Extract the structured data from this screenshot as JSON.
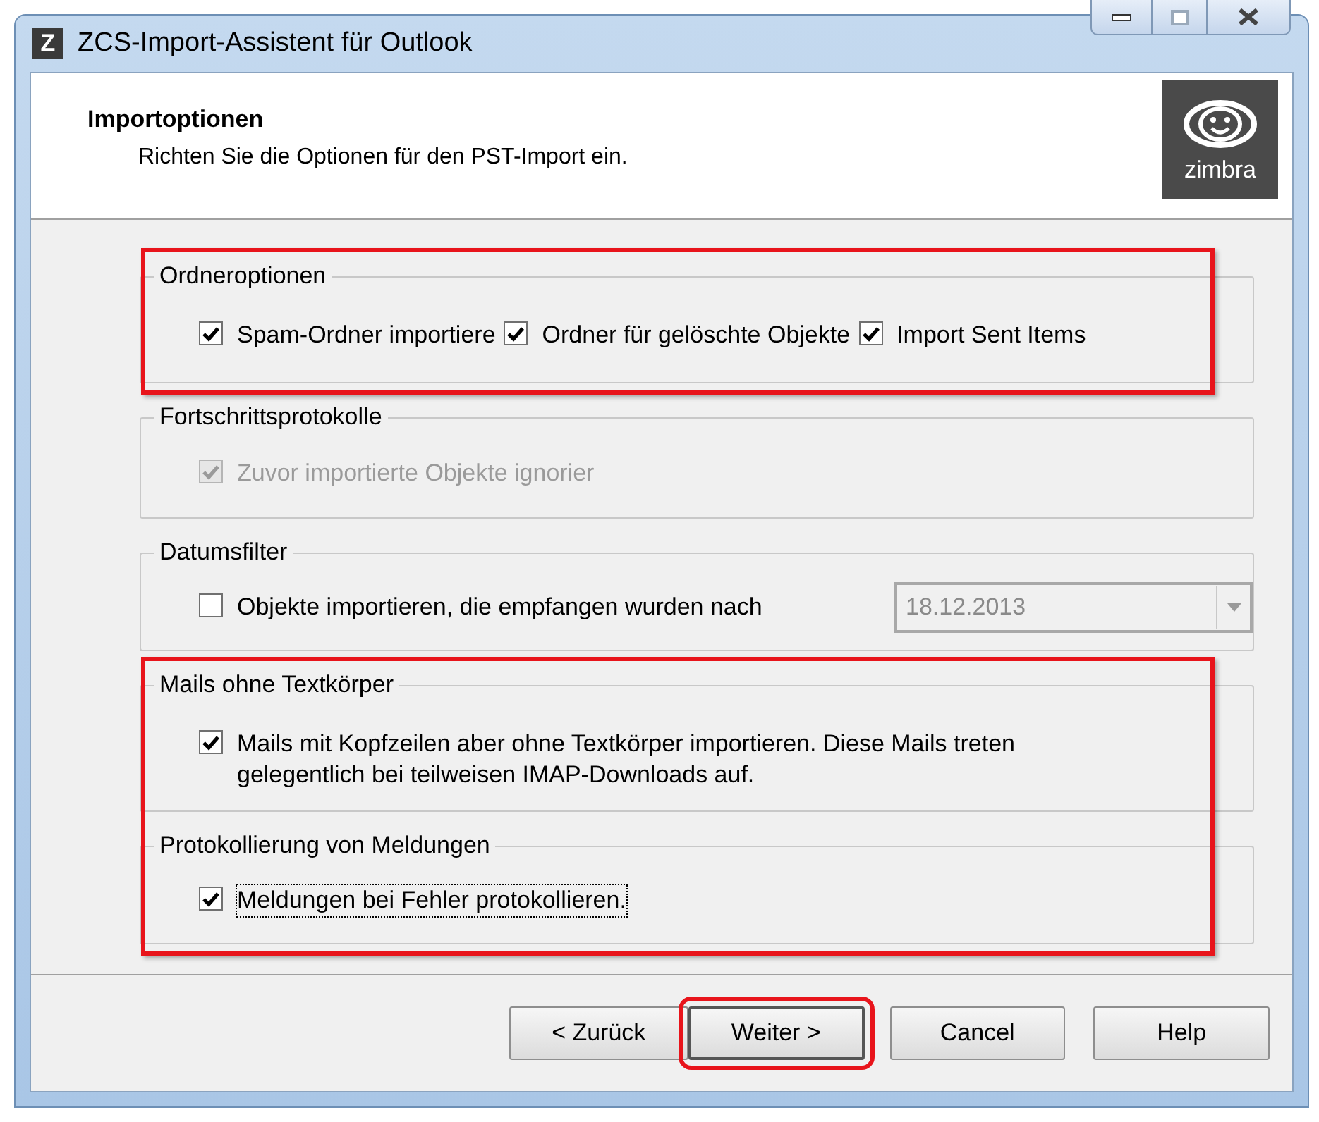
{
  "window": {
    "app_icon": "Z",
    "title": "ZCS-Import-Assistent für Outlook"
  },
  "header": {
    "title": "Importoptionen",
    "subtitle": "Richten Sie die Optionen für den PST-Import ein.",
    "logo_text": "zimbra"
  },
  "groups": [
    {
      "title": "Ordneroptionen",
      "highlighted": true,
      "options": [
        {
          "kind": "checkbox",
          "label": "Spam-Ordner importiere",
          "checked": true,
          "disabled": false
        },
        {
          "kind": "checkbox",
          "label": "Ordner für gelöschte Objekte",
          "checked": true,
          "disabled": false
        },
        {
          "kind": "checkbox",
          "label": "Import Sent Items",
          "checked": true,
          "disabled": false
        }
      ]
    },
    {
      "title": "Fortschrittsprotokolle",
      "highlighted": false,
      "options": [
        {
          "kind": "checkbox",
          "label": "Zuvor importierte Objekte ignorier",
          "checked": true,
          "disabled": true
        }
      ]
    },
    {
      "title": "Datumsfilter",
      "highlighted": false,
      "options": [
        {
          "kind": "checkbox",
          "label": "Objekte importieren, die empfangen wurden nach",
          "checked": false,
          "disabled": false
        },
        {
          "kind": "dropdown",
          "value": "18.12.2013",
          "disabled": true
        }
      ]
    },
    {
      "title": "Mails ohne Textkörper",
      "highlighted": true,
      "options": [
        {
          "kind": "checkbox",
          "label": "Mails mit Kopfzeilen aber ohne Textkörper importieren. Diese Mails treten gelegentlich bei teilweisen IMAP-Downloads auf.",
          "checked": true,
          "disabled": false
        }
      ]
    },
    {
      "title": "Protokollierung von Meldungen",
      "highlighted": true,
      "options": [
        {
          "kind": "checkbox",
          "label": "Meldungen bei Fehler protokollieren.",
          "checked": true,
          "disabled": false,
          "focused": true
        }
      ]
    }
  ],
  "buttons": [
    {
      "label": "< Zurück",
      "highlighted": false
    },
    {
      "label": "Weiter >",
      "highlighted": true
    },
    {
      "label": "Cancel",
      "highlighted": false
    },
    {
      "label": "Help",
      "highlighted": false
    }
  ]
}
